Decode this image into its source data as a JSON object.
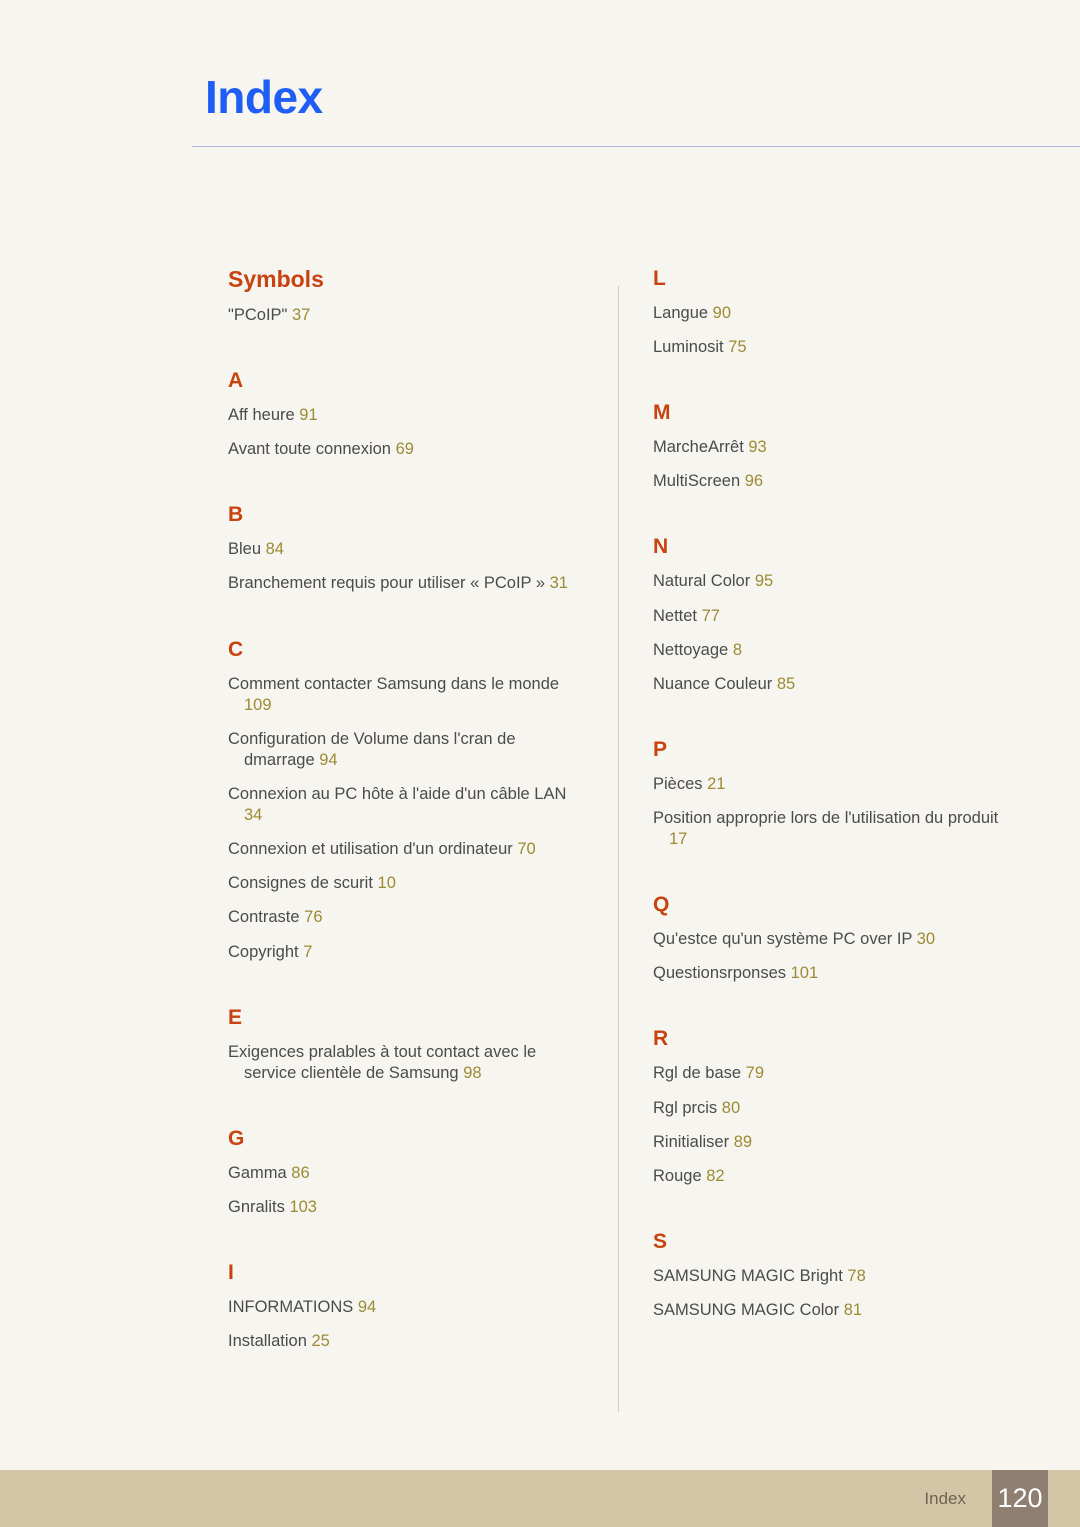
{
  "header": {
    "title": "Index"
  },
  "columns": [
    {
      "id": "left",
      "sections": [
        {
          "heading": "Symbols",
          "entries": [
            {
              "text": "\"PCoIP\"",
              "page": "37"
            }
          ]
        },
        {
          "heading": "A",
          "entries": [
            {
              "text": "Aff heure",
              "page": "91"
            },
            {
              "text": "Avant toute connexion",
              "page": "69"
            }
          ]
        },
        {
          "heading": "B",
          "entries": [
            {
              "text": "Bleu",
              "page": "84"
            },
            {
              "text": "Branchement requis pour utiliser « PCoIP »",
              "page": "31"
            }
          ]
        },
        {
          "heading": "C",
          "entries": [
            {
              "text": "Comment contacter Samsung dans le monde",
              "page": "109"
            },
            {
              "text": "Configuration de Volume dans l'cran de dmarrage",
              "page": "94"
            },
            {
              "text": "Connexion au PC hôte à l'aide d'un câble LAN",
              "page": "34"
            },
            {
              "text": "Connexion et utilisation d'un ordinateur",
              "page": "70"
            },
            {
              "text": "Consignes de scurit",
              "page": "10"
            },
            {
              "text": "Contraste",
              "page": "76"
            },
            {
              "text": "Copyright",
              "page": "7"
            }
          ]
        },
        {
          "heading": "E",
          "entries": [
            {
              "text": "Exigences pralables à tout contact avec le service clientèle de Samsung",
              "page": "98"
            }
          ]
        },
        {
          "heading": "G",
          "entries": [
            {
              "text": "Gamma",
              "page": "86"
            },
            {
              "text": "Gnralits",
              "page": "103"
            }
          ]
        },
        {
          "heading": "I",
          "entries": [
            {
              "text": "INFORMATIONS",
              "page": "94"
            },
            {
              "text": "Installation",
              "page": "25"
            }
          ]
        }
      ]
    },
    {
      "id": "right",
      "sections": [
        {
          "heading": "L",
          "entries": [
            {
              "text": "Langue",
              "page": "90"
            },
            {
              "text": "Luminosit",
              "page": "75"
            }
          ]
        },
        {
          "heading": "M",
          "entries": [
            {
              "text": "MarcheArrêt",
              "page": "93"
            },
            {
              "text": "MultiScreen",
              "page": "96"
            }
          ]
        },
        {
          "heading": "N",
          "entries": [
            {
              "text": "Natural Color",
              "page": "95"
            },
            {
              "text": "Nettet",
              "page": "77"
            },
            {
              "text": "Nettoyage",
              "page": "8"
            },
            {
              "text": "Nuance Couleur",
              "page": "85"
            }
          ]
        },
        {
          "heading": "P",
          "entries": [
            {
              "text": "Pièces",
              "page": "21"
            },
            {
              "text": "Position approprie lors de l'utilisation du produit",
              "page": "17"
            }
          ]
        },
        {
          "heading": "Q",
          "entries": [
            {
              "text": "Qu'estce qu'un système PC over IP",
              "page": "30"
            },
            {
              "text": "Questionsrponses",
              "page": "101"
            }
          ]
        },
        {
          "heading": "R",
          "entries": [
            {
              "text": "Rgl de base",
              "page": "79"
            },
            {
              "text": "Rgl prcis",
              "page": "80"
            },
            {
              "text": "Rinitialiser",
              "page": "89"
            },
            {
              "text": "Rouge",
              "page": "82"
            }
          ]
        },
        {
          "heading": "S",
          "entries": [
            {
              "text": "SAMSUNG MAGIC Bright",
              "page": "78"
            },
            {
              "text": "SAMSUNG MAGIC Color",
              "page": "81"
            }
          ]
        }
      ]
    }
  ],
  "footer": {
    "label": "Index",
    "page_number": "120"
  },
  "colors": {
    "background": "#f7f5ef",
    "title": "#1f5ef5",
    "section_heading": "#c8430f",
    "entry_text": "#4b4b4b",
    "page_number": "#9c8b34",
    "header_rule": "#b9b7d8",
    "column_divider": "#dfc8bd",
    "footer_band": "#d3c6a6",
    "footer_label": "#6e6253",
    "footer_pagenum_box": "#8e7f71"
  }
}
